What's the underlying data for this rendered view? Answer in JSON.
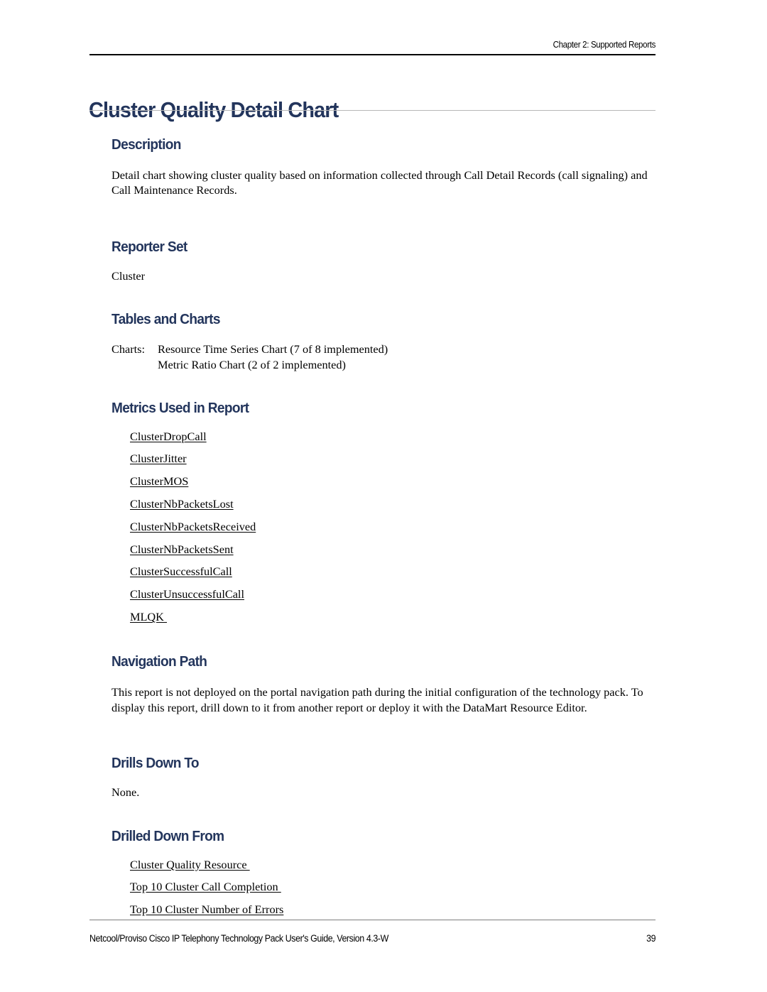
{
  "header": {
    "chapter_label": "Chapter 2: Supported Reports"
  },
  "title": "Cluster Quality Detail Chart",
  "sections": {
    "description": {
      "heading": "Description",
      "paragraph": "Detail chart showing cluster quality based on information collected through Call Detail Records (call signaling) and Call Maintenance Records."
    },
    "reporter_set": {
      "heading": "Reporter Set",
      "value": "Cluster"
    },
    "tables_and_charts": {
      "heading": "Tables and Charts",
      "charts_label": "Charts:",
      "charts": [
        "Resource Time Series Chart (7 of 8 implemented)",
        "Metric Ratio Chart (2 of 2 implemented)"
      ]
    },
    "metrics_used": {
      "heading": "Metrics Used in Report",
      "metrics": [
        "ClusterDropCall",
        "ClusterJitter",
        "ClusterMOS",
        "ClusterNbPacketsLost",
        "ClusterNbPacketsReceived",
        "ClusterNbPacketsSent",
        "ClusterSuccessfulCall",
        "ClusterUnsuccessfulCall",
        "MLQK "
      ]
    },
    "navigation_path": {
      "heading": "Navigation Path",
      "paragraph": "This report is not deployed on the portal navigation path during the initial configuration of the technology pack. To display this report, drill down to it from another report or deploy it with the DataMart Resource Editor."
    },
    "drills_down_to": {
      "heading": "Drills Down To",
      "value": "None."
    },
    "drilled_down_from": {
      "heading": "Drilled Down From",
      "links": [
        "Cluster Quality Resource ",
        "Top 10 Cluster Call Completion ",
        "Top 10 Cluster Number of Errors"
      ]
    }
  },
  "footer": {
    "text": "Netcool/Proviso Cisco IP Telephony Technology Pack User's Guide, Version 4.3-W",
    "page_number": "39"
  },
  "colors": {
    "heading": "#23355c",
    "title": "#23355c",
    "body": "#000000",
    "header_rule": "#000000",
    "title_rule": "#b8b8b8",
    "footer_rule": "#7d7d7d"
  }
}
